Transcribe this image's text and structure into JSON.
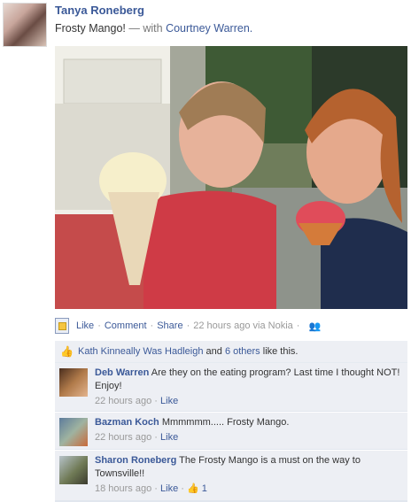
{
  "post": {
    "author": "Tanya Roneberg",
    "status_text": "Frosty Mango!",
    "with_sep": "— with",
    "with_name": "Courtney Warren."
  },
  "actions": {
    "like": "Like",
    "comment": "Comment",
    "share": "Share",
    "time": "22 hours ago via Nokia",
    "separator": "·"
  },
  "likes": {
    "names": "Kath Kinneally Was Hadleigh",
    "and": "and",
    "others": "6 others",
    "tail": "like this."
  },
  "comments": [
    {
      "name": "Deb Warren",
      "text": "Are they on the eating program? Last time I thought NOT! Enjoy!",
      "time": "22 hours ago",
      "like": "Like"
    },
    {
      "name": "Bazman Koch",
      "text": "Mmmmmm..... Frosty Mango.",
      "time": "22 hours ago",
      "like": "Like"
    },
    {
      "name": "Sharon Roneberg",
      "text": "The Frosty Mango is a must on the way to Townsville!!",
      "time": "18 hours ago",
      "like": "Like",
      "like_count": "1"
    }
  ],
  "colors": {
    "link": "#3b5998",
    "ufi_bg": "#edeff4",
    "muted": "#999999"
  },
  "icons": {
    "app": "nokia-app-icon",
    "audience": "friends-icon",
    "like": "thumbs-up-icon"
  }
}
